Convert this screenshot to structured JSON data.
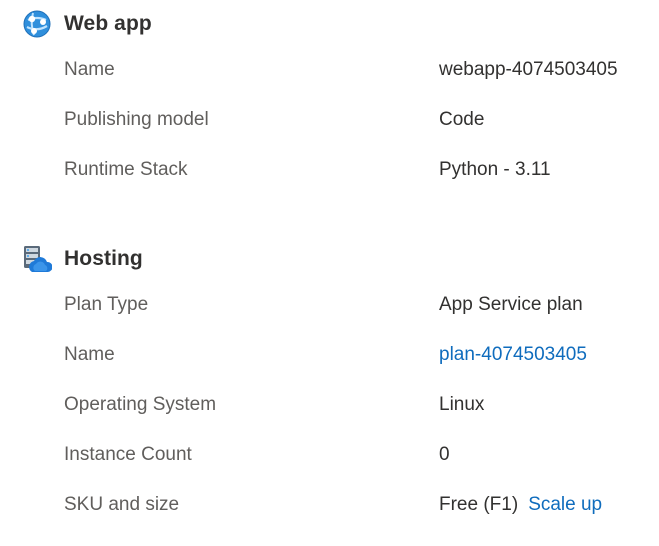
{
  "webapp": {
    "title": "Web app",
    "icon": "web-app-globe-icon",
    "rows": [
      {
        "label": "Name",
        "value": "webapp-4074503405"
      },
      {
        "label": "Publishing model",
        "value": "Code"
      },
      {
        "label": "Runtime Stack",
        "value": "Python - 3.11"
      }
    ]
  },
  "hosting": {
    "title": "Hosting",
    "icon": "hosting-server-cloud-icon",
    "rows": [
      {
        "label": "Plan Type",
        "value": "App Service plan"
      },
      {
        "label": "Name",
        "value": "plan-4074503405"
      },
      {
        "label": "Operating System",
        "value": "Linux"
      },
      {
        "label": "Instance Count",
        "value": "0"
      },
      {
        "label": "SKU and size",
        "value": "Free (F1)",
        "action": "Scale up"
      }
    ]
  },
  "colors": {
    "link": "#0f6cbd",
    "label": "#605e5c",
    "text": "#323130"
  }
}
